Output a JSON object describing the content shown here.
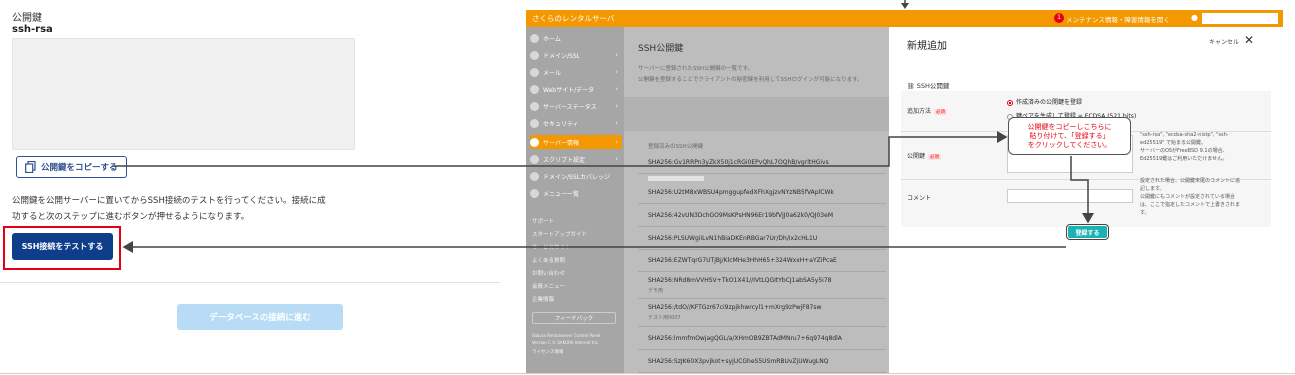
{
  "left": {
    "key_label": "公開鍵",
    "key_type": "ssh-rsa",
    "copy_button": "公開鍵をコピーする",
    "description_line1": "公開鍵を公開サーバーに置いてからSSH接続のテストを行ってください。接続に成",
    "description_line2": "功すると次のステップに進むボタンが押せるようになります。",
    "test_button": "SSH接続をテストする",
    "db_button": "データベースの接続に進む"
  },
  "shot": {
    "app_title": "さくらのレンタルサーバ",
    "notice": "メンテナンス情報・障害情報を開く",
    "notice_badge": "1",
    "sidebar": [
      {
        "label": "ホーム",
        "chev": ""
      },
      {
        "label": "ドメイン/SSL",
        "chev": "›"
      },
      {
        "label": "メール",
        "chev": "›"
      },
      {
        "label": "Webサイト/データ",
        "chev": "›"
      },
      {
        "label": "サーバーステータス",
        "chev": "›"
      },
      {
        "label": "セキュリティ",
        "chev": "›"
      },
      {
        "label": "サーバー情報",
        "chev": "›"
      },
      {
        "label": "スクリプト設定",
        "chev": "›"
      },
      {
        "label": "ドメイン/SSLカバレッジ",
        "chev": ""
      },
      {
        "label": "メニュー一覧",
        "chev": ""
      }
    ],
    "sidebar_links": [
      "サポート",
      "スタートアップガイド",
      "サービスサイト",
      "よくある質問",
      "お問い合わせ",
      "会員メニュー",
      "企業情報"
    ],
    "feedback": "フィードバック",
    "footer1": "Sakura Rentalserver Control Panel",
    "footer2": "Version C © SAKURA Internet Inc.",
    "footer3": "ライセンス情報",
    "main_title": "SSH公開鍵",
    "main_desc1": "サーバーに登録されたSSH公開鍵の一覧です。",
    "main_desc2": "公開鍵を登録することでクライアントの秘密鍵を利用してSSHログインが可能になります。",
    "list_header": "登録済みのSSH公開鍵",
    "keys": [
      {
        "fp": "SHA256:Gv1RRPn3yZkX50j1cRGi0EPvQhL7OQhB/vgrltHGivs",
        "note": ""
      },
      {
        "fp": "SHA256:U2tM8xWBSU4pmggupfedXFhXgjzvNYzNB5fVAplCWk",
        "note": ""
      },
      {
        "fp": "SHA256:42vUN3DchGO9MsKPsHN96Er19bfVjJ0a62k0/QJ03eM",
        "note": ""
      },
      {
        "fp": "SHA256:PLSUWgiiLvN1hBiaDKEnRBGar7Ur/Dh/ix2cHL1U",
        "note": ""
      },
      {
        "fp": "SHA256:EZWTqrG7UTjBj/KlcMHe3HhH65+324WxxH+aYZiPcaE",
        "note": ""
      },
      {
        "fp": "SHA256:NRd8mVVHSV+TkO1X41//IVtLQGItYbCJ1abSA5y5i78",
        "note": "デモ用"
      },
      {
        "fp": "SHA256:/tdO//KFTGzr67ci9zpjkhwrcyl1+mXrg9zPwjF87sw",
        "note": "テスト用0007"
      },
      {
        "fp": "SHA256:lmmfmOwjagQGL/a/XHmOB9ZBTAdMNru7+6q974q8dlA",
        "note": ""
      },
      {
        "fp": "SHA256:SzJK60X3pvjkot+syjUCGheS5USmRBUvZjUWugLNQ",
        "note": ""
      }
    ],
    "panel_title": "新規追加",
    "cancel": "キャンセル",
    "section": "SSH公開鍵",
    "method_label": "追加方法",
    "required": "必須",
    "opt1": "作成済みの公開鍵を登録",
    "opt2": "鍵ペアを生成して登録",
    "opt2_tail": "ECDSA (521 bits)",
    "pubkey_label": "公開鍵",
    "comment_label": "コメント",
    "hint_pub1": "\"ssh-rsa\", \"ecdsa-sha2-nistp\", \"ssh-",
    "hint_pub2": "ed25519\" で始まる公開鍵。",
    "hint_pub3": "サーバーのOSがFreeBSD 9.1の場合、",
    "hint_pub4": "Ed25519鍵はご利用いただけません。",
    "hint_cm1": "設定された場合、公開鍵末尾のコメントに追",
    "hint_cm2": "記します。",
    "hint_cm3": "公開鍵にもコメントが設定されている場合",
    "hint_cm4": "は、ここで指定したコメントで上書きされま",
    "hint_cm5": "す。",
    "register": "登録する",
    "callout1": "公開鍵をコピーしこちらに",
    "callout2": "貼り付けて、「登録する」",
    "callout3": "をクリックしてください。"
  },
  "colors": {
    "orange": "#f39800",
    "navy": "#0e3e8a",
    "red": "#e60012",
    "teal": "#1ab2b2",
    "lightblue": "#b8dcf6"
  }
}
